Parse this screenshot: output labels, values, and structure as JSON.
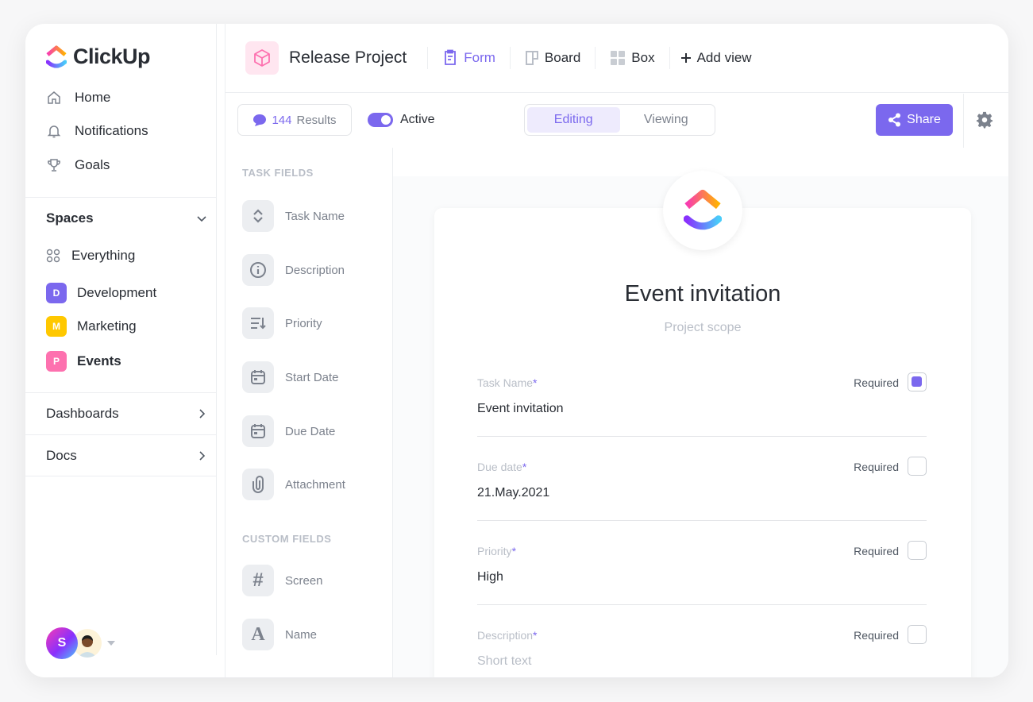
{
  "brand": {
    "name": "ClickUp",
    "accent": "#7b68ee"
  },
  "sidebar": {
    "nav": [
      {
        "label": "Home",
        "icon": "home-icon"
      },
      {
        "label": "Notifications",
        "icon": "bell-icon"
      },
      {
        "label": "Goals",
        "icon": "trophy-icon"
      }
    ],
    "spaces_label": "Spaces",
    "everything_label": "Everything",
    "spaces": [
      {
        "letter": "D",
        "label": "Development",
        "color": "#7b68ee"
      },
      {
        "letter": "M",
        "label": "Marketing",
        "color": "#ffc800"
      },
      {
        "letter": "P",
        "label": "Events",
        "color": "#fd71af"
      }
    ],
    "dashboards_label": "Dashboards",
    "docs_label": "Docs",
    "user_initial": "S"
  },
  "header": {
    "project": "Release Project",
    "views": [
      {
        "label": "Form",
        "active": true
      },
      {
        "label": "Board"
      },
      {
        "label": "Box"
      }
    ],
    "add_view": "Add view"
  },
  "toolbar": {
    "results_count": "144",
    "results_label": "Results",
    "active_label": "Active",
    "active_on": true,
    "segments": [
      "Editing",
      "Viewing"
    ],
    "share_label": "Share"
  },
  "fields": {
    "task_header": "TASK FIELDS",
    "task": [
      {
        "label": "Task Name",
        "icon": "sort-icon"
      },
      {
        "label": "Description",
        "icon": "info-icon"
      },
      {
        "label": "Priority",
        "icon": "priority-icon"
      },
      {
        "label": "Start Date",
        "icon": "calendar-icon"
      },
      {
        "label": "Due Date",
        "icon": "calendar-icon"
      },
      {
        "label": "Attachment",
        "icon": "paperclip-icon"
      }
    ],
    "custom_header": "CUSTOM FIELDS",
    "custom": [
      {
        "label": "Screen",
        "glyph": "#"
      },
      {
        "label": "Name",
        "glyph": "A"
      }
    ]
  },
  "form": {
    "title": "Event invitation",
    "subtitle": "Project scope",
    "required_label": "Required",
    "rows": [
      {
        "label": "Task Name",
        "value": "Event invitation",
        "required": true
      },
      {
        "label": "Due date",
        "value": "21.May.2021",
        "required": false
      },
      {
        "label": "Priority",
        "value": "High",
        "required": false
      },
      {
        "label": "Description",
        "placeholder": "Short text",
        "required": false
      }
    ]
  }
}
